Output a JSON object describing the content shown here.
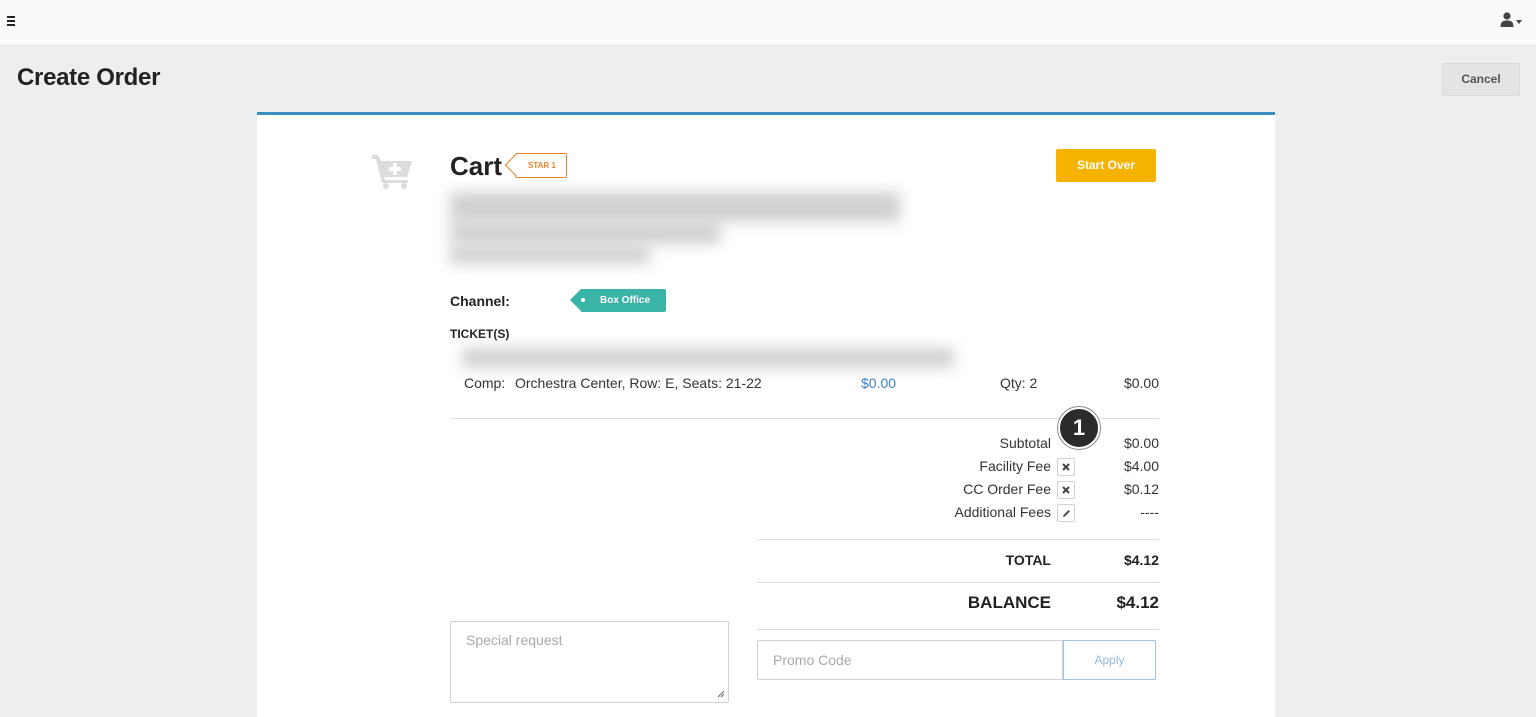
{
  "header": {
    "menu_icon": "hamburger-icon",
    "user_icon": "user-icon"
  },
  "page": {
    "title": "Create Order",
    "cancel_label": "Cancel"
  },
  "cart": {
    "title": "Cart",
    "tag": "STAR 1",
    "start_over_label": "Start Over",
    "icon": "add-to-cart-icon"
  },
  "channel": {
    "label": "Channel:",
    "value": "Box Office"
  },
  "tickets": {
    "label": "TICKET(S)",
    "items": [
      {
        "type": "Comp:",
        "description": "Orchestra Center, Row: E, Seats: 21-22",
        "price": "$0.00",
        "qty": "Qty: 2",
        "total": "$0.00"
      }
    ]
  },
  "summary": {
    "callout_number": "1",
    "subtotal_label": "Subtotal",
    "subtotal_value": "$0.00",
    "fees": [
      {
        "label": "Facility Fee",
        "value": "$4.00",
        "action_icon": "remove-icon"
      },
      {
        "label": "CC Order Fee",
        "value": "$0.12",
        "action_icon": "remove-icon"
      },
      {
        "label": "Additional Fees",
        "value": "----",
        "action_icon": "pencil-icon"
      }
    ],
    "total_label": "TOTAL",
    "total_value": "$4.12",
    "balance_label": "BALANCE",
    "balance_value": "$4.12"
  },
  "inputs": {
    "special_request_placeholder": "Special request",
    "promo_placeholder": "Promo Code",
    "apply_label": "Apply"
  },
  "colors": {
    "accent_blue": "#3b8ec2",
    "start_over": "#f5b300",
    "channel_tag": "#3ab4a6",
    "star_tag": "#e9832e",
    "price_link": "#3b7dc4"
  }
}
